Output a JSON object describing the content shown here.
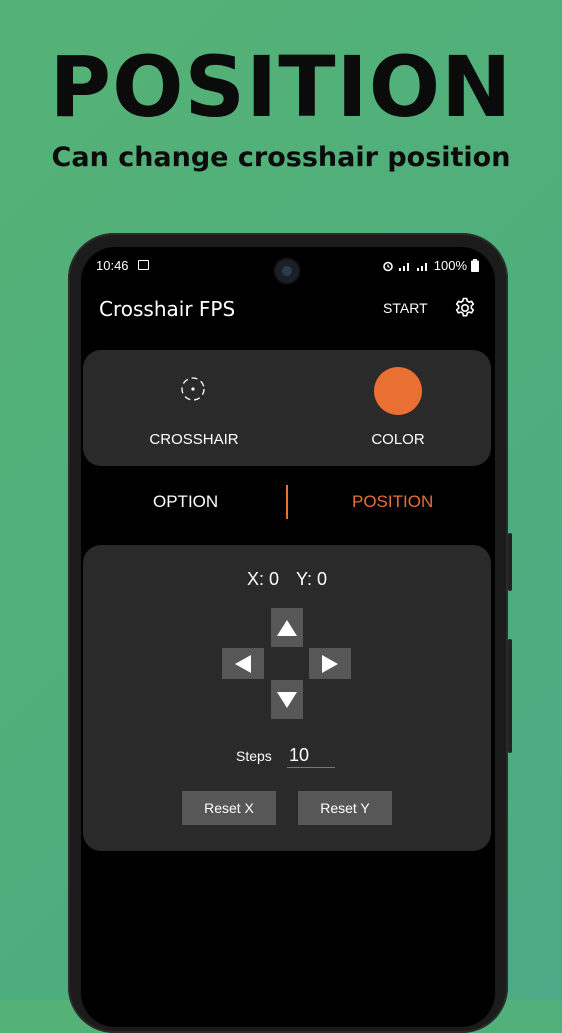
{
  "promo": {
    "title": "POSITION",
    "subtitle": "Can change crosshair position"
  },
  "status_bar": {
    "time": "10:46",
    "battery": "100%",
    "left_icons": [
      "gallery-icon"
    ],
    "right_icons": [
      "alarm-icon",
      "signal-icon",
      "signal-icon",
      "battery-icon"
    ]
  },
  "app_bar": {
    "title": "Crosshair FPS",
    "start_label": "START",
    "settings_icon": "gear-icon"
  },
  "selector": {
    "crosshair_label": "CROSSHAIR",
    "color_label": "COLOR",
    "color_value": "#e96f33"
  },
  "tabs": {
    "option_label": "OPTION",
    "position_label": "POSITION",
    "active": "POSITION",
    "active_color": "#e96f33"
  },
  "position": {
    "x_text": "X: 0",
    "y_text": "Y: 0",
    "arrows": [
      "up-arrow-icon",
      "left-arrow-icon",
      "right-arrow-icon",
      "down-arrow-icon"
    ],
    "steps_label": "Steps",
    "steps_value": "10",
    "reset_x_label": "Reset X",
    "reset_y_label": "Reset Y"
  }
}
